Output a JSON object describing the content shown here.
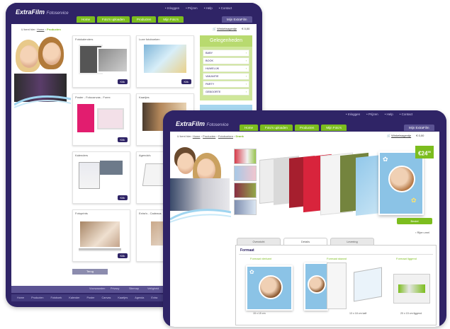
{
  "back_window": {
    "logo": "ExtraFilm",
    "logo_sub": "Fotoservice",
    "toplinks": [
      "• Inloggen",
      "• Prijzen",
      "• Help",
      "• Contact"
    ],
    "tabs": [
      "Home",
      "Foto's uploaden",
      "Producten",
      "Mijn Foto's"
    ],
    "account_button": "Mijn ExtraFilm",
    "breadcrumb": {
      "prefix": "U bent hier:",
      "home": "Home",
      "current": "Producten"
    },
    "cart": {
      "label": "Winkelwagentje",
      "amount": "€ 0,00"
    },
    "tiles": [
      {
        "title": "Fotokalenders",
        "button": "Klik"
      },
      {
        "title": "Luxe fotoboeken",
        "button": "Klik"
      },
      {
        "title": "Poster - Fotocanvas - Forex",
        "button": "Klik"
      },
      {
        "title": "Kaartjes",
        "button": "Klik"
      },
      {
        "title": "Kalenders",
        "button": "Klik"
      },
      {
        "title": "Agenda's",
        "button": "Klik"
      },
      {
        "title": "Fotoprints",
        "button": "Klik"
      },
      {
        "title": "Extra's - Cadeaus",
        "button": "Klik"
      }
    ],
    "sidebar": {
      "title": "Gelegenheden",
      "items": [
        "BABY",
        "BOOK",
        "HUWELIJK",
        "VAKANTIE",
        "PARTY",
        "GEBOORTE"
      ]
    },
    "bottom_button": "Terug",
    "footer_links": [
      "Voorwaarden",
      "Privacy",
      "Sitemap",
      "Veiligheid"
    ],
    "footer_bottom": [
      "Home",
      "Producten",
      "Fotoboek",
      "Kalender",
      "Poster",
      "Canvas",
      "Kaartjes",
      "Agenda",
      "Extra"
    ]
  },
  "front_window": {
    "logo": "ExtraFilm",
    "logo_sub": "Fotoservice",
    "toplinks": [
      "• Inloggen",
      "• Prijzen",
      "• Help",
      "• Contact"
    ],
    "tabs": [
      "Home",
      "Foto's uploaden",
      "Producten",
      "Mijn Foto's"
    ],
    "account_button": "Mijn ExtraFilm",
    "breadcrumb": {
      "prefix": "U bent hier:",
      "home": "Home",
      "p1": "Producten",
      "p2": "Fotoboeken",
      "current": "Drank"
    },
    "cart": {
      "label": "Winkelwagentje",
      "amount": "€ 0,00"
    },
    "price": "€24",
    "price_cents": "95",
    "order_button": "Bestel",
    "link_more": "› Rijen veel",
    "tabs2": [
      "Overzicht",
      "Details",
      "Levering"
    ],
    "section_title": "Formaat",
    "formats": [
      {
        "title": "Formaat vierkant",
        "desc": "15 x 15 cm"
      },
      {
        "title": "Formaat staand",
        "desc": "13 x 18 cm kaft"
      },
      {
        "title": "Formaat liggend",
        "desc": "20 x 15 cm liggend"
      }
    ],
    "colors": {
      "brand": "#2f2466",
      "accent": "#7cbd1e",
      "price": "#7cbd1e"
    }
  }
}
